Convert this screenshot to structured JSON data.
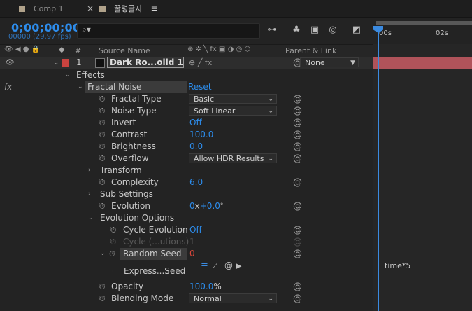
{
  "tabs": [
    {
      "label": "Comp 1"
    },
    {
      "label": "꿀렁글자"
    }
  ],
  "timecode": "0;00;00;00",
  "fps": "00000 (29.97 fps)",
  "search": {
    "placeholder": ""
  },
  "ruler": {
    "t0": "00s",
    "t1": "02s"
  },
  "columns": {
    "hash": "#",
    "source_name": "Source Name",
    "parent_link": "Parent & Link"
  },
  "layer": {
    "number": "1",
    "name": "Dark Ro...olid 1",
    "parent": "None",
    "color": "#c9433f",
    "bar_color": "#b0535a"
  },
  "effects_label": "Effects",
  "fx_label": "fx",
  "effect": {
    "name": "Fractal Noise",
    "reset": "Reset"
  },
  "props": {
    "fractal_type": {
      "label": "Fractal Type",
      "value": "Basic"
    },
    "noise_type": {
      "label": "Noise Type",
      "value": "Soft Linear"
    },
    "invert": {
      "label": "Invert",
      "value": "Off"
    },
    "contrast": {
      "label": "Contrast",
      "value": "100.0"
    },
    "brightness": {
      "label": "Brightness",
      "value": "0.0"
    },
    "overflow": {
      "label": "Overflow",
      "value": "Allow HDR Results"
    },
    "transform": {
      "label": "Transform"
    },
    "complexity": {
      "label": "Complexity",
      "value": "6.0"
    },
    "sub_settings": {
      "label": "Sub Settings"
    },
    "evolution": {
      "label": "Evolution",
      "value_a": "0",
      "value_b": "x",
      "value_c": "+0.0",
      "value_d": "°"
    },
    "evolution_options": {
      "label": "Evolution Options"
    },
    "cycle_evolution": {
      "label": "Cycle Evolution",
      "value": "Off"
    },
    "cycle_revolutions": {
      "label": "Cycle (...utions)",
      "value": "1"
    },
    "random_seed": {
      "label": "Random Seed",
      "value": "0"
    },
    "expression": {
      "label": "Express...Seed",
      "text": "time*5"
    },
    "opacity": {
      "label": "Opacity",
      "value": "100.0",
      "unit": "%"
    },
    "blending_mode": {
      "label": "Blending Mode",
      "value": "Normal"
    }
  }
}
